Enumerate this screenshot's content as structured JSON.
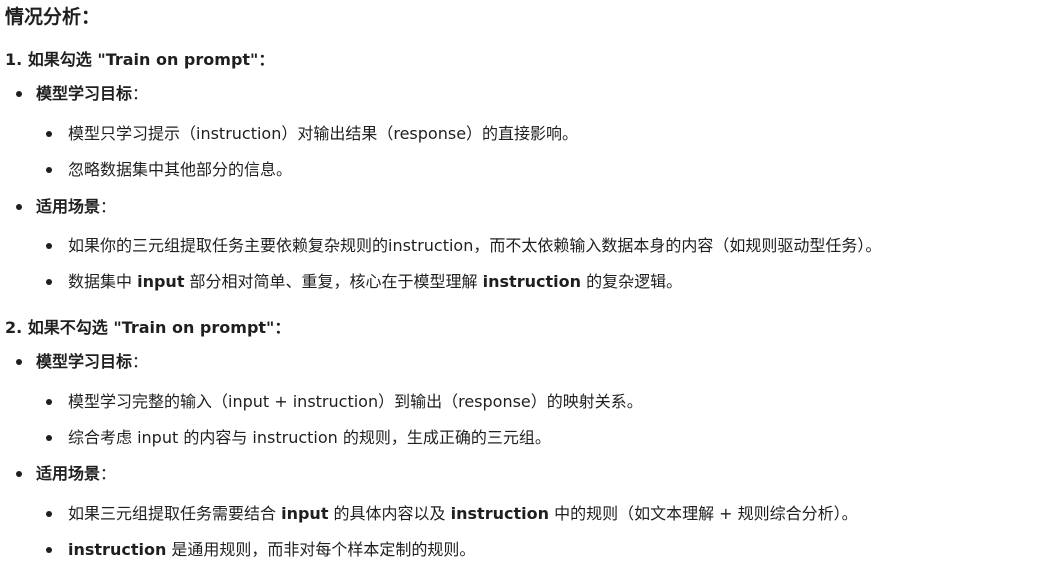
{
  "title": "情况分析：",
  "sections": [
    {
      "heading": "1. 如果勾选 \"Train on prompt\"：",
      "groups": [
        {
          "label": "模型学习目标",
          "colon": "：",
          "items": [
            {
              "parts": [
                "模型只学习提示（instruction）对输出结果（response）的直接影响。"
              ]
            },
            {
              "parts": [
                "忽略数据集中其他部分的信息。"
              ]
            }
          ]
        },
        {
          "label": "适用场景",
          "colon": "：",
          "items": [
            {
              "parts": [
                "如果你的三元组提取任务主要依赖复杂规则的instruction，而不太依赖输入数据本身的内容（如规则驱动型任务）。"
              ]
            },
            {
              "parts": [
                "数据集中 ",
                "input",
                " 部分相对简单、重复，核心在于模型理解 ",
                "instruction",
                " 的复杂逻辑。"
              ]
            }
          ]
        }
      ]
    },
    {
      "heading": "2. 如果不勾选 \"Train on prompt\"：",
      "groups": [
        {
          "label": "模型学习目标",
          "colon": "：",
          "items": [
            {
              "parts": [
                "模型学习完整的输入（input + instruction）到输出（response）的映射关系。"
              ]
            },
            {
              "parts": [
                "综合考虑 input 的内容与 instruction 的规则，生成正确的三元组。"
              ]
            }
          ]
        },
        {
          "label": "适用场景",
          "colon": "：",
          "items": [
            {
              "parts": [
                "如果三元组提取任务需要结合 ",
                "input",
                " 的具体内容以及 ",
                "instruction",
                " 中的规则（如文本理解 + 规则综合分析）。"
              ]
            },
            {
              "parts": [
                "",
                "instruction",
                " 是通用规则，而非对每个样本定制的规则。"
              ]
            }
          ]
        }
      ]
    }
  ]
}
